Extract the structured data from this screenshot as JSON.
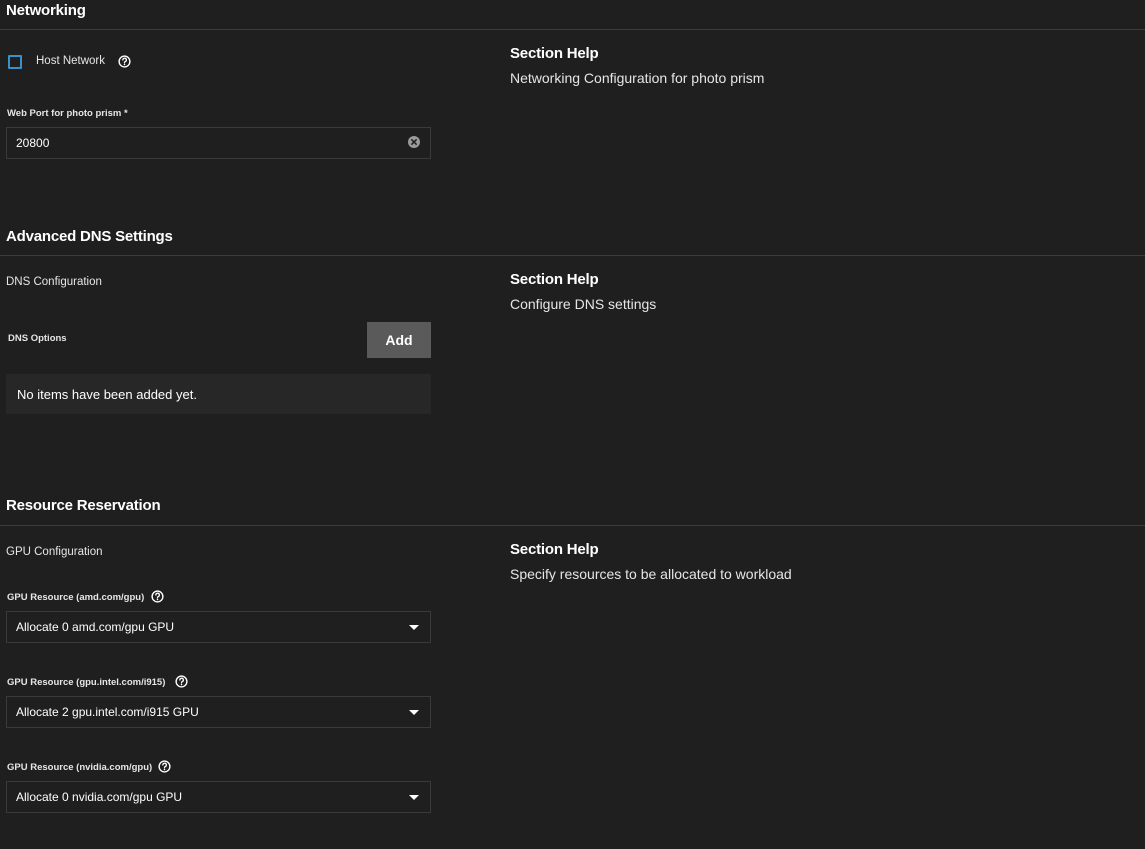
{
  "networking": {
    "title": "Networking",
    "host_network_label": "Host Network",
    "web_port_label": "Web Port for photo prism *",
    "web_port_value": "20800",
    "help_title": "Section Help",
    "help_text": "Networking Configuration for photo prism"
  },
  "dns": {
    "title": "Advanced DNS Settings",
    "config_label": "DNS Configuration",
    "options_label": "DNS Options",
    "add_label": "Add",
    "empty_text": "No items have been added yet.",
    "help_title": "Section Help",
    "help_text": "Configure DNS settings"
  },
  "resources": {
    "title": "Resource Reservation",
    "gpu_config_label": "GPU Configuration",
    "help_title": "Section Help",
    "help_text": "Specify resources to be allocated to workload",
    "gpus": [
      {
        "label": "GPU Resource (amd.com/gpu)",
        "value": "Allocate 0 amd.com/gpu GPU"
      },
      {
        "label": "GPU Resource (gpu.intel.com/i915)",
        "value": "Allocate 2 gpu.intel.com/i915 GPU"
      },
      {
        "label": "GPU Resource (nvidia.com/gpu)",
        "value": "Allocate 0 nvidia.com/gpu GPU"
      }
    ]
  },
  "icons": {
    "help": "help-circle-icon",
    "clear": "clear-circle-icon",
    "dropdown": "caret-down-icon"
  },
  "colors": {
    "background": "#1f1f1f",
    "checkbox_border": "#3d8fcc",
    "button_bg": "#5a5a5a"
  }
}
